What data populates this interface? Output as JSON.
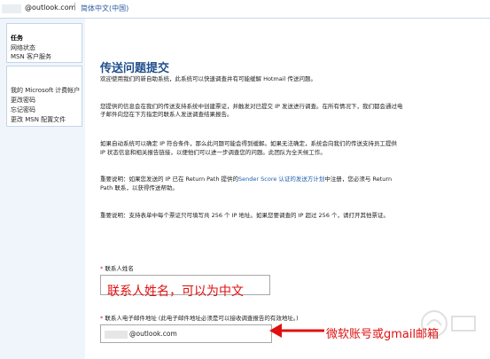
{
  "header": {
    "account_email_suffix": "@outlook.com",
    "language": "简体中文(中国)"
  },
  "sidebar": {
    "section_title": "任务",
    "group1": [
      "网络状态",
      "MSN 客户服务"
    ],
    "group2": [
      "我的 Microsoft 计费帐户",
      "更改密码",
      "忘记密码",
      "更改 MSN 配置文件"
    ]
  },
  "main": {
    "title": "传送问题提交",
    "p1": "欢迎使用我们的新自助系统，此系统可以快速调查并有可能缓解 Hotmail 传送问题。",
    "p2a": "您提供的信息会在我们的传送支持系统中创建票证，并触发对已提交 IP 发送进行调查。在所有情况下，我们都会通过电",
    "p2b": "子邮件向您在下方指定的联系人发送调查结果报告。",
    "p3a": "如果自动系统可以确定 IP 符合条件，那么此问题可能会得到缓解。如果无法确定，系统会向我们的传送支持员工提供",
    "p3b": "IP 状态信息和相关报告链接，以便他们可以进一步调查您的问题。此团队为全天候工作。",
    "p4a": "重要说明：如果您发送的 IP 已在 Return Path 提供的",
    "p4_link": "Sender Score 认证的发送方计划",
    "p4b": "中注册，您必须与 Return",
    "p4c": "Path 联系，以获得传送帮助。",
    "p5": "重要说明：支持表单中每个票证只可填写共 256 个 IP 地址。如果您要调查的 IP 超过 256 个，请打开其他票证。",
    "required_mark": "*",
    "field1_label": "联系人姓名",
    "field2_label": "联系人电子邮件地址 (此电子邮件地址必须是可以接收调查报告的有效地址。)",
    "field2_value_suffix": "@outlook.com"
  },
  "annotations": {
    "name_hint": "联系人姓名，可以为中文",
    "email_hint": "微软账号或gmail邮箱"
  },
  "colors": {
    "title": "#1f4e8c",
    "link": "#2060b0",
    "annotation": "#e01010",
    "sidebar_bg": "#f0f5fb"
  }
}
